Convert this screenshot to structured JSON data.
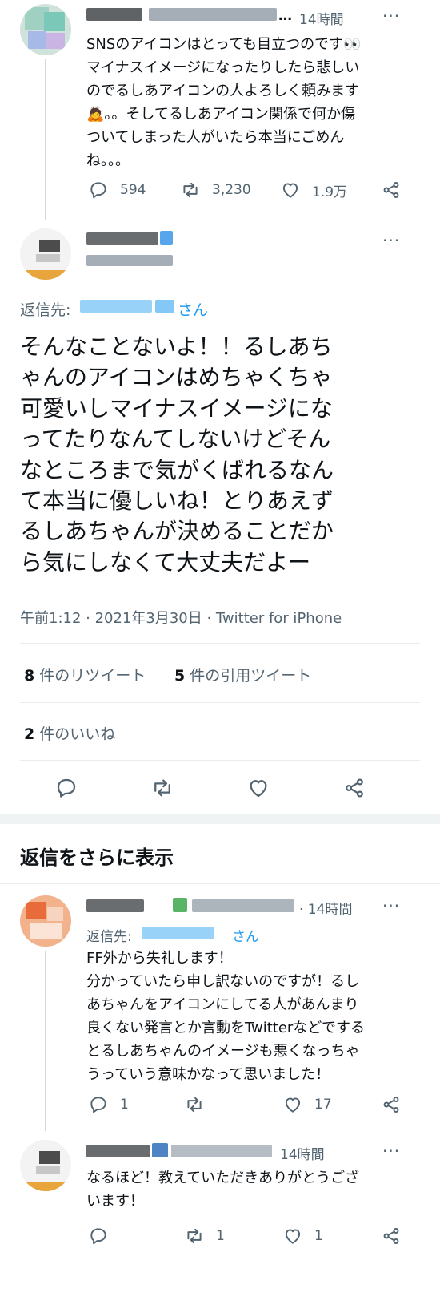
{
  "tweet1": {
    "time": "14時間",
    "text": "SNSのアイコンはとっても目立つのです👀\nマイナスイメージになったりしたら悲しい\nのでるしあアイコンの人よろしく頼みます\n🙇。。そしてるしあアイコン関係で何か傷\nついてしまった人がいたら本当にごめん\nね。。。",
    "replies": "594",
    "retweets": "3,230",
    "likes": "1.9万"
  },
  "main": {
    "reply_to_prefix": "返信先:",
    "reply_to_suffix": "さん",
    "text": "そんなことないよ！！るしあち\nゃんのアイコンはめちゃくちゃ\n可愛いしマイナスイメージにな\nってたりなんてしないけどそん\nなところまで気がくばれるなん\nて本当に優しいね！とりあえず\nるしあちゃんが決めることだか\nら気にしなくて大丈夫だよー",
    "meta": "午前1:12 · 2021年3月30日 · Twitter for iPhone",
    "retweet_count": "8",
    "retweet_label": " 件のリツイート",
    "quote_count": "5",
    "quote_label": " 件の引用ツイート",
    "like_count": "2",
    "like_label": " 件のいいね"
  },
  "more_replies": "返信をさらに表示",
  "reply1": {
    "time": "· 14時間",
    "reply_to_prefix": "返信先:",
    "reply_to_suffix": "さん",
    "text": "FF外から失礼します！\n分かっていたら申し訳ないのですが！るし\nあちゃんをアイコンにしてる人があんまり\n良くない発言とか言動をTwitterなどでする\nとるしあちゃんのイメージも悪くなっちゃ\nうっていう意味かなって思いました！",
    "replies": "1",
    "retweets": "",
    "likes": "17"
  },
  "reply2": {
    "time": "14時間",
    "text": "なるほど！教えていただきありがとうござ\nいます！",
    "replies": "",
    "retweets": "1",
    "likes": "1"
  },
  "icons": {
    "reply": "reply-icon",
    "retweet": "retweet-icon",
    "like": "heart-icon",
    "share": "share-icon",
    "more": "more-icon"
  },
  "colors": {
    "link": "#1d9bf0",
    "grey": "#536471"
  }
}
